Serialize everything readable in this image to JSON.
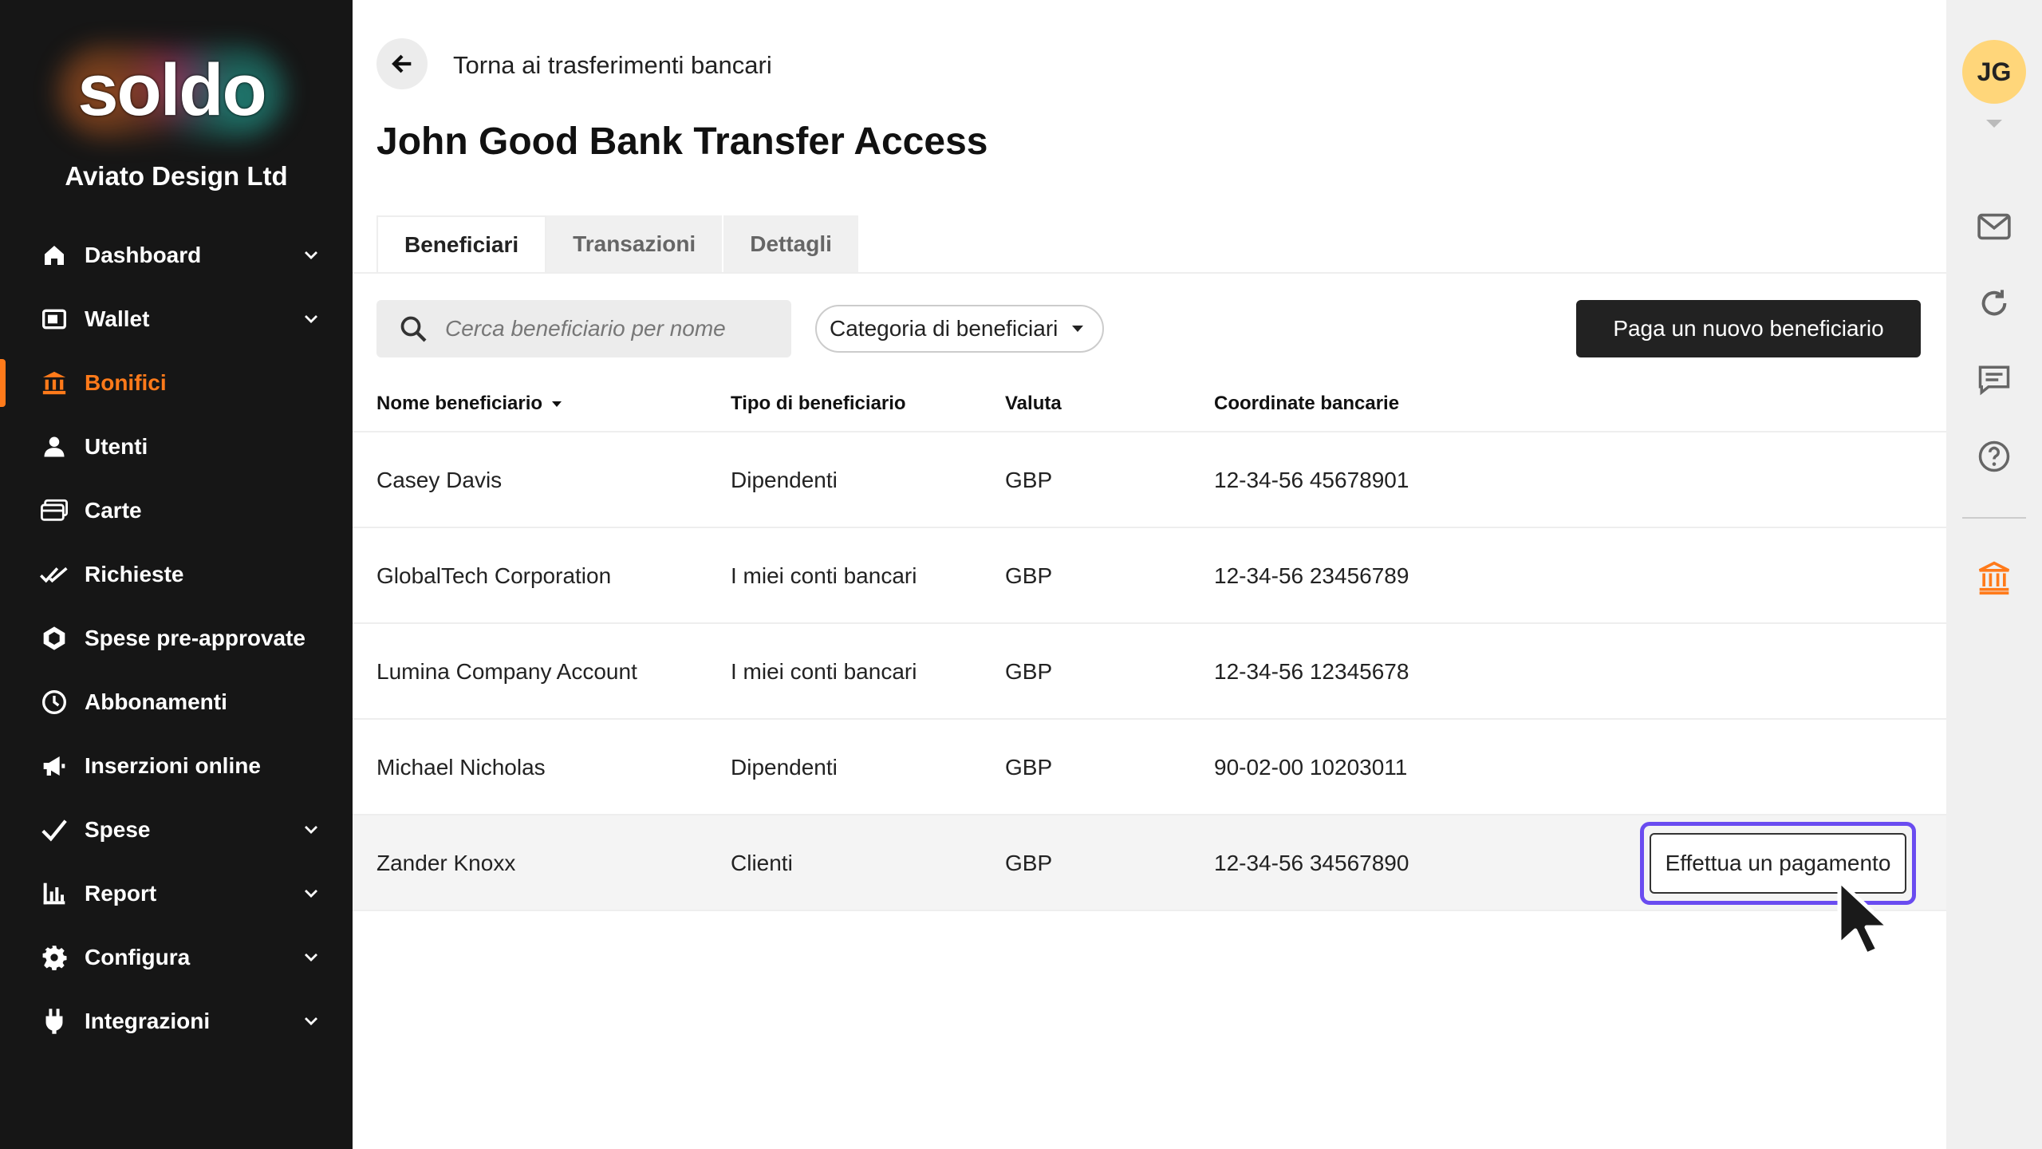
{
  "brand": {
    "logo": "soldo",
    "company": "Aviato Design Ltd"
  },
  "sidebar": {
    "items": [
      {
        "label": "Dashboard",
        "icon": "home-icon",
        "has_chevron": true
      },
      {
        "label": "Wallet",
        "icon": "wallet-icon",
        "has_chevron": true
      },
      {
        "label": "Bonifici",
        "icon": "bank-transfer-icon",
        "has_chevron": false,
        "active": true
      },
      {
        "label": "Utenti",
        "icon": "user-icon",
        "has_chevron": false
      },
      {
        "label": "Carte",
        "icon": "cards-icon",
        "has_chevron": false
      },
      {
        "label": "Richieste",
        "icon": "double-check-icon",
        "has_chevron": false
      },
      {
        "label": "Spese pre-approvate",
        "icon": "hexagon-badge-icon",
        "has_chevron": false
      },
      {
        "label": "Abbonamenti",
        "icon": "clock-icon",
        "has_chevron": false
      },
      {
        "label": "Inserzioni online",
        "icon": "megaphone-icon",
        "has_chevron": false
      },
      {
        "label": "Spese",
        "icon": "check-icon",
        "has_chevron": true
      },
      {
        "label": "Report",
        "icon": "bar-chart-icon",
        "has_chevron": true
      },
      {
        "label": "Configura",
        "icon": "gear-icon",
        "has_chevron": true
      },
      {
        "label": "Integrazioni",
        "icon": "plug-icon",
        "has_chevron": true
      }
    ],
    "accent": "#ff7a1a"
  },
  "header": {
    "back_label": "Torna ai trasferimenti bancari",
    "title": "John Good Bank Transfer Access"
  },
  "tabs": [
    {
      "label": "Beneficiari",
      "active": true
    },
    {
      "label": "Transazioni",
      "active": false
    },
    {
      "label": "Dettagli",
      "active": false
    }
  ],
  "toolbar": {
    "search_placeholder": "Cerca beneficiario per nome",
    "filter_label": "Categoria di beneficiari",
    "cta_label": "Paga un nuovo beneficiario"
  },
  "table": {
    "columns": [
      "Nome beneficiario",
      "Tipo di beneficiario",
      "Valuta",
      "Coordinate bancarie"
    ],
    "rows": [
      {
        "name": "Casey Davis",
        "type": "Dipendenti",
        "currency": "GBP",
        "bank": "12-34-56 45678901"
      },
      {
        "name": "GlobalTech Corporation",
        "type": "I miei conti bancari",
        "currency": "GBP",
        "bank": "12-34-56 23456789"
      },
      {
        "name": "Lumina Company Account",
        "type": "I miei conti bancari",
        "currency": "GBP",
        "bank": "12-34-56 12345678"
      },
      {
        "name": "Michael Nicholas",
        "type": "Dipendenti",
        "currency": "GBP",
        "bank": "90-02-00 10203011"
      },
      {
        "name": "Zander Knoxx",
        "type": "Clienti",
        "currency": "GBP",
        "bank": "12-34-56 34567890"
      }
    ],
    "row_action": "Effettua un pagamento",
    "highlight_color": "#6a4cf0"
  },
  "rail": {
    "avatar_initials": "JG",
    "avatar_color": "#ffd67a",
    "icons": [
      "mail-icon",
      "refresh-icon",
      "chat-icon",
      "help-icon",
      "bank-icon"
    ]
  }
}
